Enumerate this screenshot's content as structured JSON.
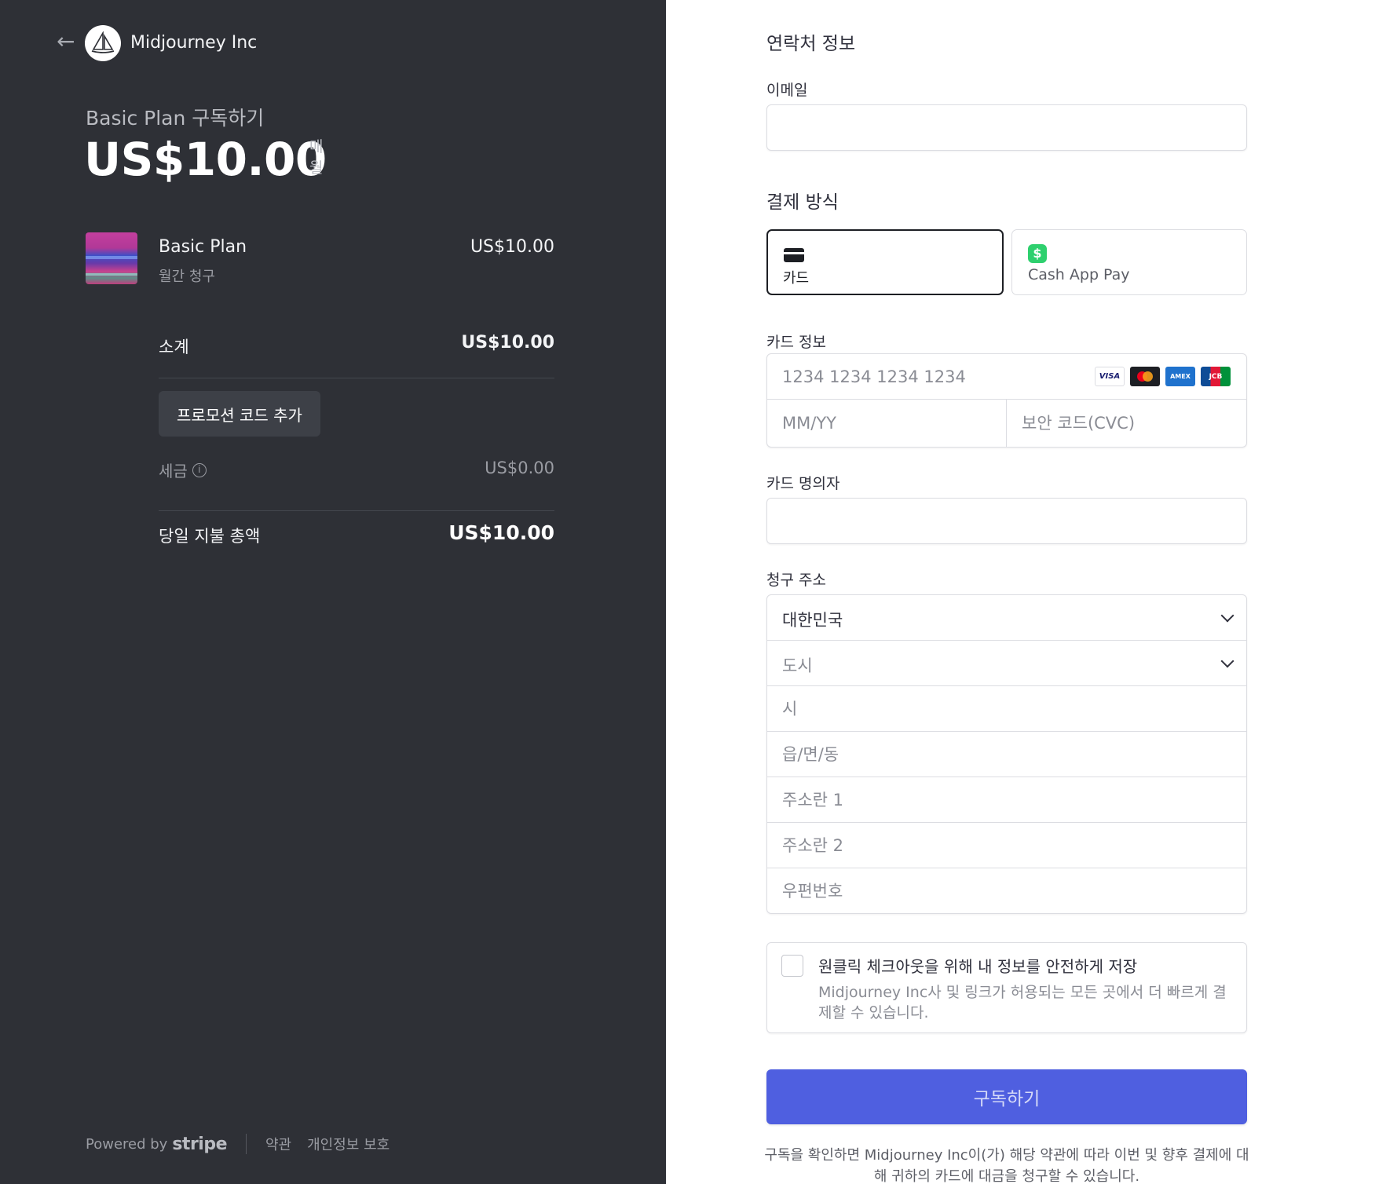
{
  "merchant": {
    "name": "Midjourney Inc",
    "logo_icon": "sailboat-icon",
    "back_icon": "arrow-left-icon"
  },
  "summary": {
    "subscribe_title": "Basic Plan 구독하기",
    "price": "US$10.00",
    "period_line1": "매",
    "period_line2": "월"
  },
  "item": {
    "name": "Basic Plan",
    "billing": "월간 청구",
    "price": "US$10.00"
  },
  "subtotal": {
    "label": "소계",
    "value": "US$10.00"
  },
  "promo": {
    "label": "프로모션 코드 추가"
  },
  "tax": {
    "label": "세금",
    "value": "US$0.00",
    "info_icon": "info-icon"
  },
  "total": {
    "label": "당일 지불 총액",
    "value": "US$10.00"
  },
  "footer": {
    "powered_by": "Powered by",
    "brand": "stripe",
    "terms": "약관",
    "privacy": "개인정보 보호"
  },
  "contact": {
    "title": "연락처 정보",
    "email_label": "이메일",
    "email_value": ""
  },
  "payment": {
    "title": "결제 방식",
    "tabs": [
      {
        "label": "카드",
        "icon": "credit-card-icon",
        "selected": true
      },
      {
        "label": "Cash App Pay",
        "icon": "cash-app-icon",
        "selected": false
      }
    ]
  },
  "card": {
    "label": "카드 정보",
    "number_placeholder": "1234 1234 1234 1234",
    "expiry_placeholder": "MM/YY",
    "cvc_placeholder": "보안 코드(CVC)",
    "brands": [
      "VISA",
      "MC",
      "AMEX",
      "JCB"
    ]
  },
  "cardholder": {
    "label": "카드 명의자",
    "value": ""
  },
  "billing": {
    "label": "청구 주소",
    "country": "대한민국",
    "province_placeholder": "도시",
    "city_placeholder": "시",
    "district_placeholder": "읍/면/동",
    "line1_placeholder": "주소란 1",
    "line2_placeholder": "주소란 2",
    "postal_placeholder": "우편번호"
  },
  "save_info": {
    "title": "원클릭 체크아웃을 위해 내 정보를 안전하게 저장",
    "description": "Midjourney Inc사 및 링크가 허용되는 모든 곳에서 더 빠르게 결제할 수 있습니다.",
    "checked": false
  },
  "submit": {
    "label": "구독하기",
    "color": "#4f5fe0"
  },
  "legal": {
    "text": "구독을 확인하면 Midjourney Inc이(가) 해당 약관에 따라 이번 및 향후 결제에 대해 귀하의 카드에 대금을 청구할 수 있습니다."
  },
  "colors": {
    "left_panel_bg": "#2e3036",
    "accent": "#4f5fe0"
  }
}
